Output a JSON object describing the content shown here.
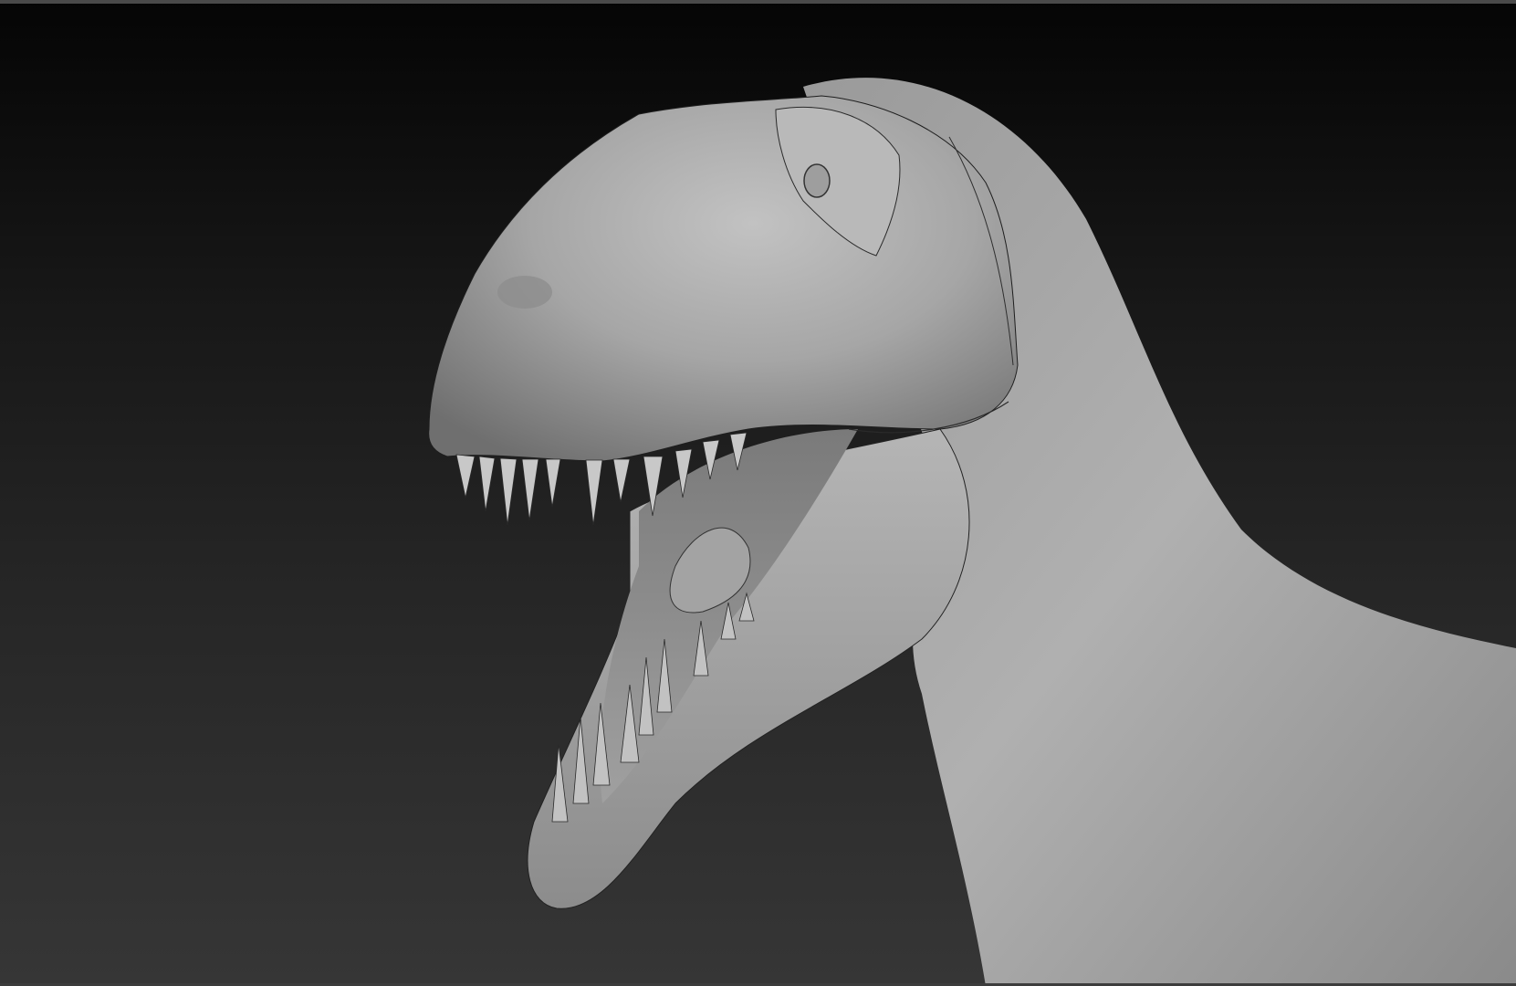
{
  "viewport": {
    "background_top": "#050505",
    "background_bottom": "#363636",
    "model_material_color": "#a9a9a9",
    "model_subject": "t-rex-head-sculpt"
  }
}
